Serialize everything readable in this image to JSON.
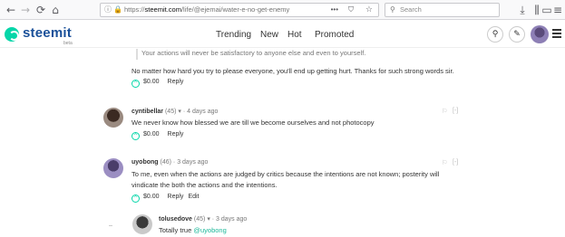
{
  "browser": {
    "back_glyph": "←",
    "forward_glyph": "→",
    "reload_glyph": "⟳",
    "home_glyph": "⌂",
    "info_glyph": "ⓘ",
    "lock_glyph": "🔒",
    "url_prefix": "https://",
    "url_domain": "steemit.com",
    "url_path": "/life/@ejemai/water-e-no-get-enemy",
    "more_glyph": "•••",
    "pocket_glyph": "⛉",
    "star_glyph": "☆",
    "search_placeholder": "Search",
    "download_glyph": "⤓",
    "library_glyph": "⫼",
    "sidebar_glyph": "▭",
    "menu_glyph": "≡"
  },
  "header": {
    "logo_text": "steemit",
    "logo_beta": "beta",
    "nav": [
      "Trending",
      "New",
      "Hot",
      "Promoted"
    ],
    "search_glyph": "⚲",
    "edit_glyph": "✎"
  },
  "comments": {
    "quote_text": "Your actions will never be satisfactory to anyone else and even to yourself.",
    "first_body": "No matter how hard you try to please everyone, you'll end up getting hurt. Thanks for such strong words sir.",
    "first_payout": "$0.00",
    "first_reply": "Reply",
    "c1": {
      "author": "cyntibellar",
      "rep": "(45)",
      "caret": "▾",
      "time": "· 4 days ago",
      "body": "We never know how blessed we are till we become ourselves and not photocopy",
      "payout": "$0.00",
      "reply": "Reply",
      "collapse": "[-]"
    },
    "c2": {
      "author": "uyobong",
      "rep": "(46)",
      "time": "· 3 days ago",
      "body_line1": "To me, even when the actions are judged by critics because the intentions are not known; posterity will",
      "body_line2": "vindicate the both the actions and the intentions.",
      "payout": "$0.00",
      "reply": "Reply",
      "edit": "Edit",
      "collapse": "[-]"
    },
    "c3": {
      "author": "tolusedove",
      "rep": "(45)",
      "caret": "▾",
      "time": "· 3 days ago",
      "body_text": "Totally true ",
      "mention": "@uyobong"
    },
    "upvote_glyph": "^",
    "flag_glyph": "⚐"
  },
  "colors": {
    "brand_green": "#06d6a9",
    "brand_blue": "#1a5099",
    "mention": "#1fb99b"
  }
}
